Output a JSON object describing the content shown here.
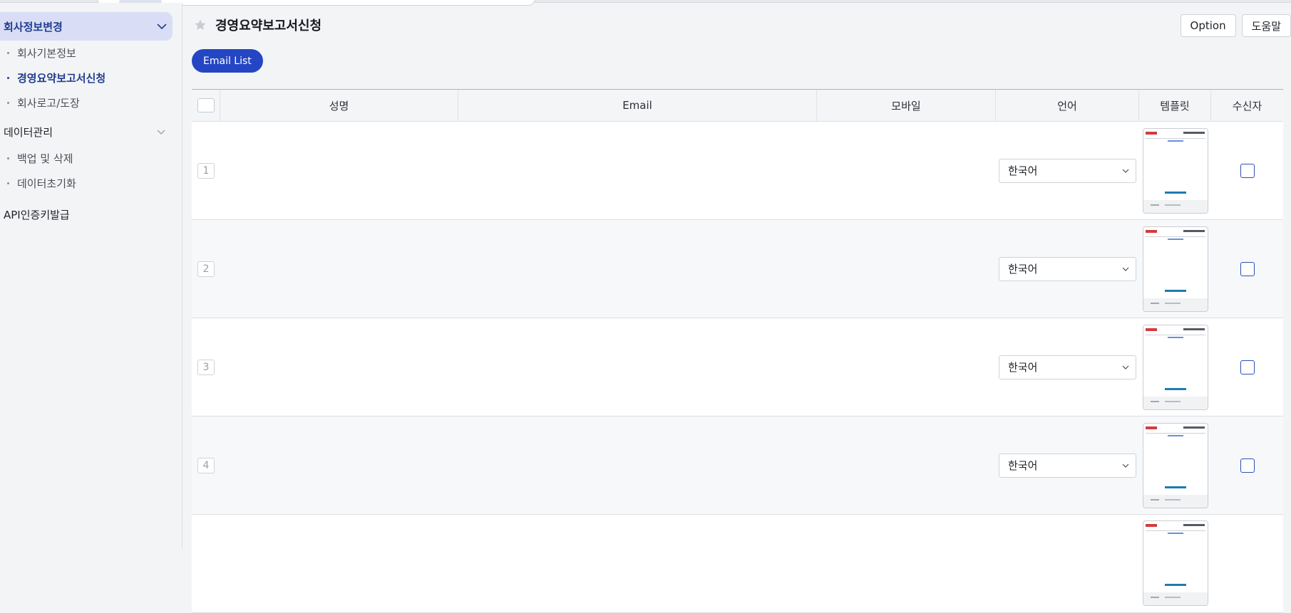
{
  "sidebar": {
    "group1": {
      "label": "회사정보변경",
      "items": [
        {
          "label": "회사기본정보"
        },
        {
          "label": "경영요약보고서신청"
        },
        {
          "label": "회사로고/도장"
        }
      ]
    },
    "group2": {
      "label": "데이터관리",
      "items": [
        {
          "label": "백업 및 삭제"
        },
        {
          "label": "데이터초기화"
        }
      ]
    },
    "api": {
      "label": "API인증키발급"
    }
  },
  "page": {
    "title": "경영요약보고서신청",
    "option_label": "Option",
    "help_label": "도움말",
    "email_list_label": "Email List"
  },
  "table": {
    "columns": [
      "성명",
      "Email",
      "모바일",
      "언어",
      "템플릿",
      "수신자"
    ],
    "rows": [
      {
        "num": "1",
        "name": "",
        "email": "",
        "mobile": "",
        "language": "한국어"
      },
      {
        "num": "2",
        "name": "",
        "email": "",
        "mobile": "",
        "language": "한국어"
      },
      {
        "num": "3",
        "name": "",
        "email": "",
        "mobile": "",
        "language": "한국어"
      },
      {
        "num": "4",
        "name": "",
        "email": "",
        "mobile": "",
        "language": "한국어"
      }
    ]
  },
  "colors": {
    "accent": "#2446c4",
    "active_bg": "#d9def6",
    "active_text": "#203d8f"
  },
  "icons": [
    "chevron-down-icon",
    "star-icon",
    "caret-down-icon"
  ]
}
